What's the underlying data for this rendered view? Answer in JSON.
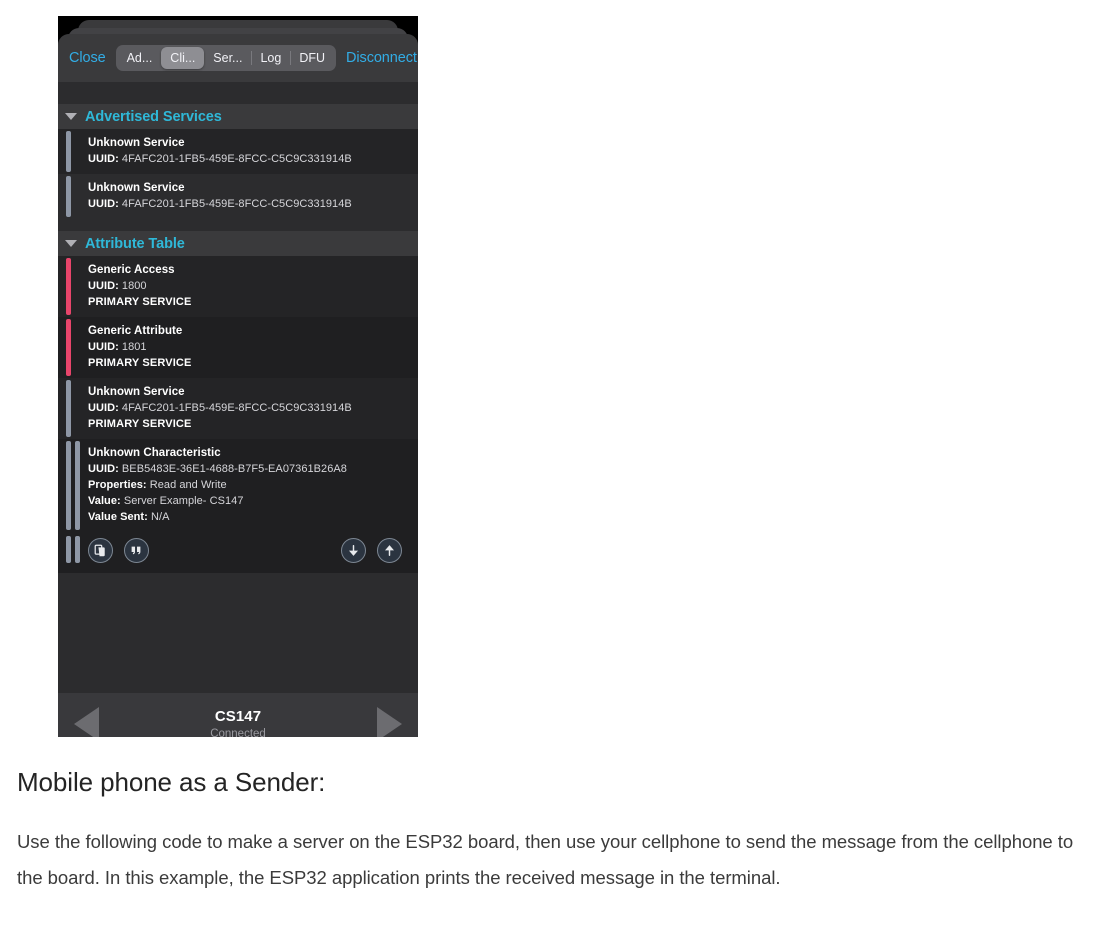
{
  "phone_screenshot": {
    "navbar": {
      "close_label": "Close",
      "disconnect_label": "Disconnect",
      "segments": [
        {
          "label": "Ad...",
          "selected": false
        },
        {
          "label": "Cli...",
          "selected": true
        },
        {
          "label": "Ser...",
          "selected": false
        },
        {
          "label": "Log",
          "selected": false
        },
        {
          "label": "DFU",
          "selected": false
        }
      ]
    },
    "sections": [
      {
        "title": "Advertised Services",
        "rows": [
          {
            "title": "Unknown Service",
            "uuid_label": "UUID:",
            "uuid_value": "4FAFC201-1FB5-459E-8FCC-C5C9C331914B"
          },
          {
            "title": "Unknown Service",
            "uuid_label": "UUID:",
            "uuid_value": "4FAFC201-1FB5-459E-8FCC-C5C9C331914B"
          }
        ]
      },
      {
        "title": "Attribute Table",
        "rows": [
          {
            "title": "Generic Access",
            "uuid_label": "UUID:",
            "uuid_value": "1800",
            "caption": "PRIMARY SERVICE"
          },
          {
            "title": "Generic Attribute",
            "uuid_label": "UUID:",
            "uuid_value": "1801",
            "caption": "PRIMARY SERVICE"
          },
          {
            "title": "Unknown Service",
            "uuid_label": "UUID:",
            "uuid_value": "4FAFC201-1FB5-459E-8FCC-C5C9C331914B",
            "caption": "PRIMARY SERVICE"
          }
        ],
        "characteristic": {
          "title": "Unknown Characteristic",
          "uuid_label": "UUID:",
          "uuid_value": "BEB5483E-36E1-4688-B7F5-EA07361B26A8",
          "properties_label": "Properties:",
          "properties_value": "Read and Write",
          "value_label": "Value:",
          "value_value": "Server Example- CS147",
          "value_sent_label": "Value Sent:",
          "value_sent_value": "N/A"
        }
      }
    ],
    "bottombar": {
      "device_name": "CS147",
      "status": "Connected"
    }
  },
  "article": {
    "heading": "Mobile phone as a Sender:",
    "paragraph": "Use the following code to make a server on the ESP32 board, then use your cellphone to send the message from the cellphone to the board. In this example, the ESP32 application prints the received message in the terminal."
  },
  "colors": {
    "accent_link": "#32ade6",
    "section_title": "#2fb8d8",
    "service_bar": "#e8456b",
    "unknown_bar": "#8e97a6",
    "sheet_bg": "#1c1c1e"
  }
}
